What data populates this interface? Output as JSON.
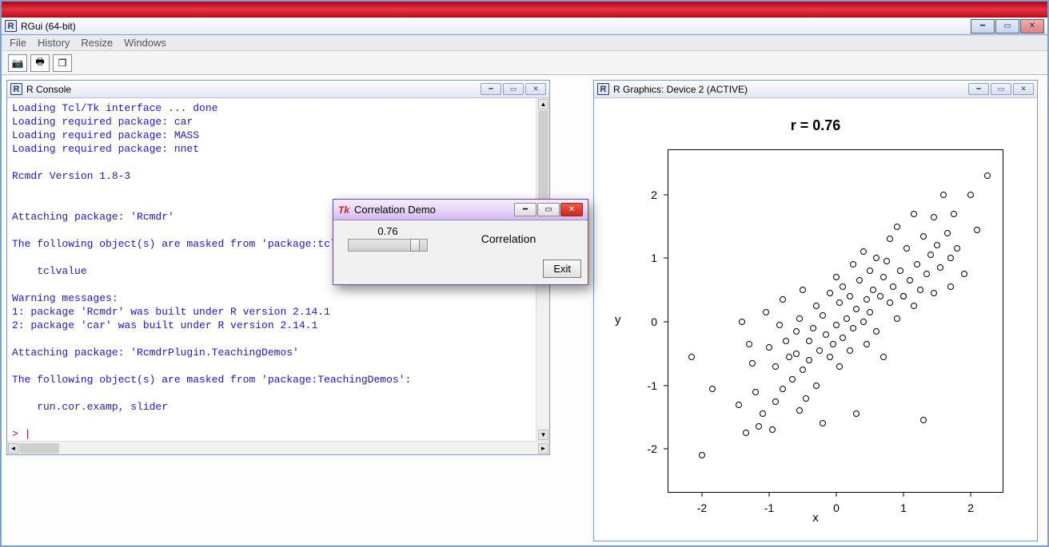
{
  "window": {
    "title": "RGui (64-bit)",
    "menu": [
      "File",
      "History",
      "Resize",
      "Windows"
    ],
    "toolbar": [
      "camera",
      "print",
      "cascade"
    ]
  },
  "console": {
    "title": "R Console",
    "lines": "Loading Tcl/Tk interface ... done\nLoading required package: car\nLoading required package: MASS\nLoading required package: nnet\n\nRcmdr Version 1.8-3\n\n\nAttaching package: 'Rcmdr'\n\nThe following object(s) are masked from 'package:tcltk':\n\n    tclvalue\n\nWarning messages:\n1: package 'Rcmdr' was built under R version 2.14.1 \n2: package 'car' was built under R version 2.14.1 \n\nAttaching package: 'RcmdrPlugin.TeachingDemos'\n\nThe following object(s) are masked from 'package:TeachingDemos':\n\n    run.cor.examp, slider\n",
    "prompt": "> "
  },
  "graphics": {
    "title": "R Graphics: Device 2 (ACTIVE)"
  },
  "dialog": {
    "title": "Correlation Demo",
    "value": "0.76",
    "slider_pos": 0.76,
    "label": "Correlation",
    "exit": "Exit"
  },
  "chart_data": {
    "type": "scatter",
    "title": "r =  0.76",
    "xlabel": "x",
    "ylabel": "y",
    "xlim": [
      -2.5,
      2.5
    ],
    "ylim": [
      -2.7,
      2.7
    ],
    "xticks": [
      -2,
      -1,
      0,
      1,
      2
    ],
    "yticks": [
      -2,
      -1,
      0,
      1,
      2
    ],
    "series": [
      {
        "name": "points",
        "x": [
          -2.15,
          -2.0,
          -1.85,
          -1.45,
          -1.4,
          -1.35,
          -1.3,
          -1.25,
          -1.2,
          -1.15,
          -1.1,
          -1.05,
          -1.0,
          -0.95,
          -0.9,
          -0.9,
          -0.85,
          -0.8,
          -0.8,
          -0.75,
          -0.7,
          -0.65,
          -0.6,
          -0.6,
          -0.55,
          -0.55,
          -0.5,
          -0.5,
          -0.45,
          -0.4,
          -0.4,
          -0.35,
          -0.3,
          -0.3,
          -0.25,
          -0.2,
          -0.2,
          -0.15,
          -0.1,
          -0.1,
          -0.05,
          0.0,
          0.0,
          0.05,
          0.05,
          0.1,
          0.1,
          0.15,
          0.2,
          0.2,
          0.25,
          0.25,
          0.3,
          0.3,
          0.35,
          0.4,
          0.4,
          0.45,
          0.45,
          0.5,
          0.5,
          0.55,
          0.6,
          0.6,
          0.65,
          0.7,
          0.7,
          0.75,
          0.8,
          0.8,
          0.85,
          0.9,
          0.9,
          0.95,
          1.0,
          1.0,
          1.05,
          1.1,
          1.15,
          1.15,
          1.2,
          1.25,
          1.3,
          1.3,
          1.35,
          1.4,
          1.45,
          1.45,
          1.5,
          1.55,
          1.6,
          1.65,
          1.7,
          1.7,
          1.75,
          1.8,
          1.9,
          2.0,
          2.1,
          2.25
        ],
        "y": [
          -0.55,
          -2.1,
          -1.05,
          -1.3,
          0.0,
          -1.75,
          -0.35,
          -0.65,
          -1.1,
          -1.65,
          -1.45,
          0.15,
          -0.4,
          -1.7,
          -0.7,
          -1.25,
          -0.05,
          -1.05,
          0.35,
          -0.3,
          -0.55,
          -0.9,
          -0.15,
          -0.5,
          -1.4,
          0.05,
          -0.75,
          0.5,
          -1.2,
          -0.3,
          -0.6,
          -0.1,
          -1.0,
          0.25,
          -0.45,
          -1.6,
          0.1,
          -0.2,
          -0.55,
          0.45,
          -0.35,
          -0.05,
          0.7,
          0.3,
          -0.7,
          -0.25,
          0.55,
          0.05,
          -0.45,
          0.4,
          -0.1,
          0.9,
          0.2,
          -1.45,
          0.65,
          0.0,
          1.1,
          0.35,
          -0.35,
          0.8,
          0.15,
          0.5,
          -0.15,
          1.0,
          0.4,
          0.7,
          -0.55,
          0.95,
          0.3,
          1.3,
          0.55,
          0.05,
          1.5,
          0.8,
          0.4,
          0.4,
          1.15,
          0.65,
          0.25,
          1.7,
          0.9,
          0.5,
          1.35,
          -1.55,
          0.75,
          1.05,
          0.45,
          1.65,
          1.2,
          0.85,
          2.0,
          1.4,
          1.0,
          0.55,
          1.7,
          1.15,
          0.75,
          2.0,
          1.45,
          2.3
        ]
      }
    ]
  }
}
